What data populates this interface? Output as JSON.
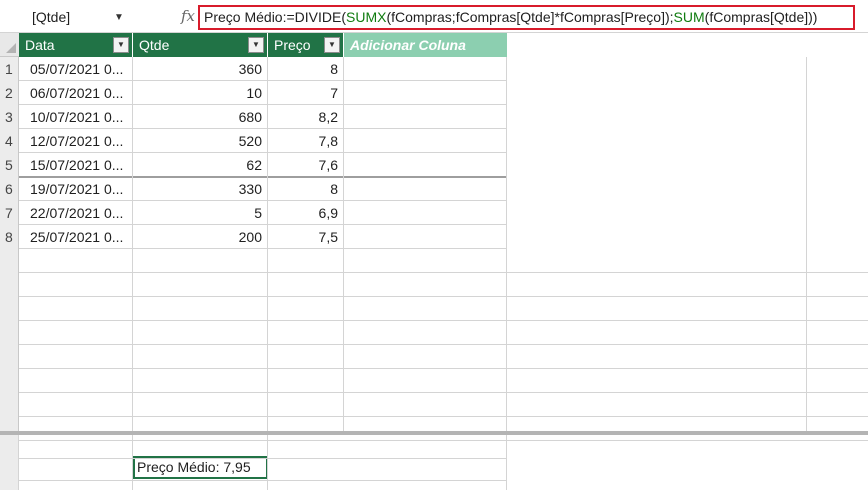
{
  "formula_bar": {
    "name_box": "[Qtde]",
    "fx_label": "fx",
    "formula_parts": [
      {
        "text": "Preço Médio:=DIVIDE(",
        "green": false
      },
      {
        "text": "SUMX",
        "green": true
      },
      {
        "text": "(fCompras;fCompras[Qtde]*fCompras[Preço]);",
        "green": false
      },
      {
        "text": "SUM",
        "green": true
      },
      {
        "text": "(fCompras[Qtde]))",
        "green": false
      }
    ]
  },
  "table": {
    "columns": [
      "Data",
      "Qtde",
      "Preço"
    ],
    "add_column_label": "Adicionar Coluna",
    "rows": [
      {
        "n": "1",
        "data": "05/07/2021 0...",
        "qtde": "360",
        "preco": "8"
      },
      {
        "n": "2",
        "data": "06/07/2021 0...",
        "qtde": "10",
        "preco": "7"
      },
      {
        "n": "3",
        "data": "10/07/2021 0...",
        "qtde": "680",
        "preco": "8,2"
      },
      {
        "n": "4",
        "data": "12/07/2021 0...",
        "qtde": "520",
        "preco": "7,8"
      },
      {
        "n": "5",
        "data": "15/07/2021 0...",
        "qtde": "62",
        "preco": "7,6"
      },
      {
        "n": "6",
        "data": "19/07/2021 0...",
        "qtde": "330",
        "preco": "8"
      },
      {
        "n": "7",
        "data": "22/07/2021 0...",
        "qtde": "5",
        "preco": "6,9"
      },
      {
        "n": "8",
        "data": "25/07/2021 0...",
        "qtde": "200",
        "preco": "7,5"
      }
    ]
  },
  "measures": {
    "preco_medio": "Preço Médio: 7,95"
  }
}
